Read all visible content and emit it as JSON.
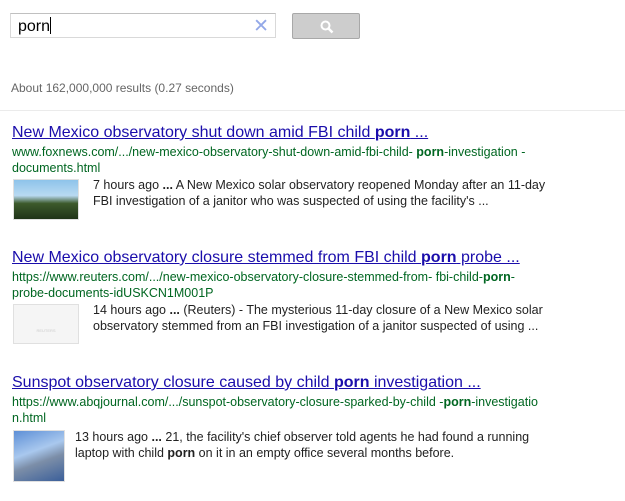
{
  "search": {
    "query": "porn",
    "clear_icon": "close-icon",
    "button_icon": "search-icon"
  },
  "stats": "About 162,000,000 results (0.27 seconds)",
  "results": [
    {
      "title": {
        "pre": "New Mexico observatory shut down amid FBI child ",
        "bold": "porn",
        "post": " ..."
      },
      "url": {
        "pre": "www.foxnews.com/.../new-mexico-observatory-shut-down-amid-fbi-child- ",
        "bold": "porn",
        "post": "-investigation -documents.html"
      },
      "snippet": {
        "date": "7 hours ago",
        "dots": "...",
        "text": " A New Mexico solar observatory reopened Monday after an 11-day FBI investigation of a janitor who was suspected of using the facility's ..."
      }
    },
    {
      "title": {
        "pre": "New Mexico observatory closure stemmed from FBI child ",
        "bold": "porn",
        "post": " probe ..."
      },
      "url": {
        "pre": "https://www.reuters.com/.../new-mexico-observatory-closure-stemmed-from- fbi-child-",
        "bold": "porn",
        "post": "-probe-documents-idUSKCN1M001P"
      },
      "snippet": {
        "date": "14 hours ago",
        "dots": "...",
        "text": " (Reuters) - The mysterious 11-day closure of a New Mexico solar observatory stemmed from an FBI investigation of a janitor suspected of using ..."
      },
      "thumb_logo": "REUTERS"
    },
    {
      "title": {
        "pre": "Sunspot observatory closure caused by child ",
        "bold": "porn",
        "post": " investigation ..."
      },
      "url": {
        "pre": "https://www.abqjournal.com/.../sunspot-observatory-closure-sparked-by-child -",
        "bold": "porn",
        "post": "-investigation.html"
      },
      "snippet": {
        "date": "13 hours ago",
        "dots": "...",
        "text1": " 21, the facility's chief observer told agents he had found a running laptop with child ",
        "bold": "porn",
        "text2": " on it in an empty office several months before."
      }
    }
  ]
}
